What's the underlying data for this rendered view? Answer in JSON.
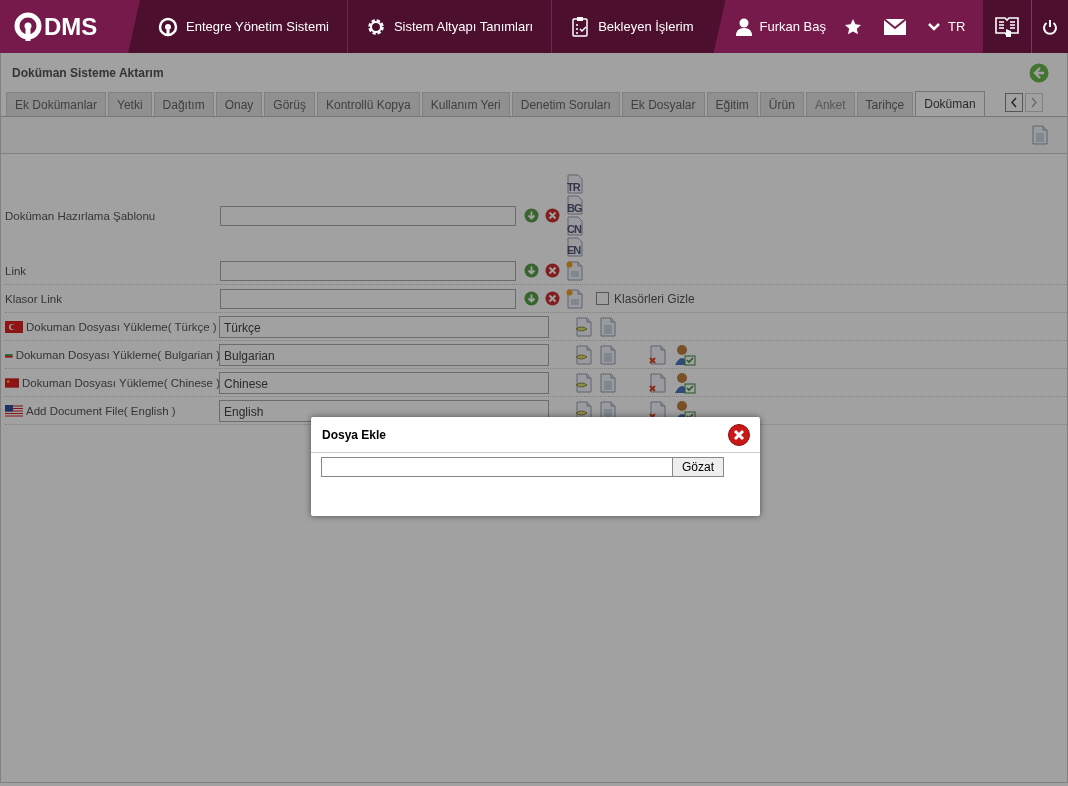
{
  "header": {
    "logo": "DMS",
    "nav": [
      {
        "label": "Entegre Yönetim Sistemi"
      },
      {
        "label": "Sistem Altyapı Tanımları"
      },
      {
        "label": "Bekleyen İşlerim"
      }
    ],
    "user": "Furkan Baş",
    "language": "TR"
  },
  "page": {
    "title": "Doküman Sisteme Aktarım"
  },
  "tabs": [
    {
      "label": "Ek Dokümanlar",
      "selected": false,
      "disabled": false
    },
    {
      "label": "Yetki",
      "selected": false,
      "disabled": false
    },
    {
      "label": "Dağıtım",
      "selected": false,
      "disabled": false
    },
    {
      "label": "Onay",
      "selected": false,
      "disabled": false
    },
    {
      "label": "Görüş",
      "selected": false,
      "disabled": false
    },
    {
      "label": "Kontrollü Kopya",
      "selected": false,
      "disabled": false
    },
    {
      "label": "Kullanım Yeri",
      "selected": false,
      "disabled": false
    },
    {
      "label": "Denetim Soruları",
      "selected": false,
      "disabled": false
    },
    {
      "label": "Ek Dosyalar",
      "selected": false,
      "disabled": false
    },
    {
      "label": "Eğitim",
      "selected": false,
      "disabled": false
    },
    {
      "label": "Ürün",
      "selected": false,
      "disabled": false
    },
    {
      "label": "Anket",
      "selected": false,
      "disabled": true
    },
    {
      "label": "Tarihçe",
      "selected": false,
      "disabled": false
    },
    {
      "label": "Doküman",
      "selected": true,
      "disabled": false
    }
  ],
  "form": {
    "template": {
      "label": "Doküman Hazırlama Şablonu",
      "languages": [
        "TR",
        "BG",
        "CN",
        "EN"
      ]
    },
    "links": [
      {
        "label": "Link"
      },
      {
        "label": "Klasor Link",
        "checkbox": {
          "label": "Klasörleri Gizle",
          "checked": false
        }
      }
    ],
    "uploads": [
      {
        "label": "Dokuman Dosyası Yükleme( Türkçe )",
        "value": "Türkçe",
        "extra_actions": false
      },
      {
        "label": "Dokuman Dosyası Yükleme( Bulgarian )",
        "value": "Bulgarian",
        "extra_actions": true
      },
      {
        "label": "Dokuman Dosyası Yükleme( Chinese )",
        "value": "Chinese",
        "extra_actions": true
      },
      {
        "label": "Add Document File( English )",
        "value": "English",
        "extra_actions": true
      }
    ]
  },
  "dialog": {
    "title": "Dosya Ekle",
    "button": "Gözat"
  }
}
